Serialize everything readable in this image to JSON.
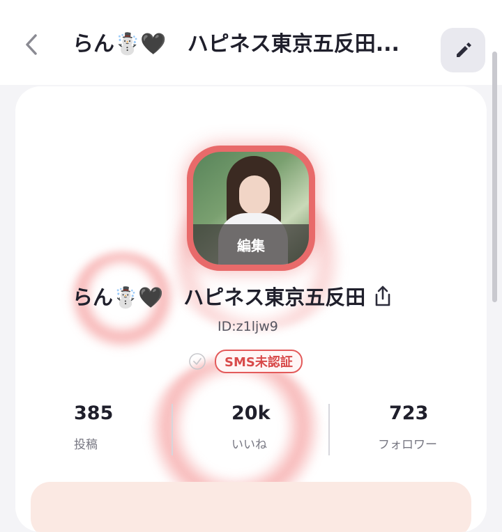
{
  "header": {
    "back_icon": "chevron-left-icon",
    "title": "らん☃️🖤　ハピネス東京五反田...",
    "edit_icon": "pencil-icon"
  },
  "profile": {
    "avatar_edit_label": "編集",
    "name": "らん☃️🖤　ハピネス東京五反田",
    "share_icon": "share-icon",
    "user_id": "ID:z1ljw9",
    "verify_badge": "SMS未認証",
    "check_icon": "check-circle-icon"
  },
  "stats": [
    {
      "value": "385",
      "label": "投稿"
    },
    {
      "value": "20k",
      "label": "いいね"
    },
    {
      "value": "723",
      "label": "フォロワー"
    }
  ],
  "colors": {
    "accent": "#e35a5a",
    "background": "#f4f4f7"
  }
}
